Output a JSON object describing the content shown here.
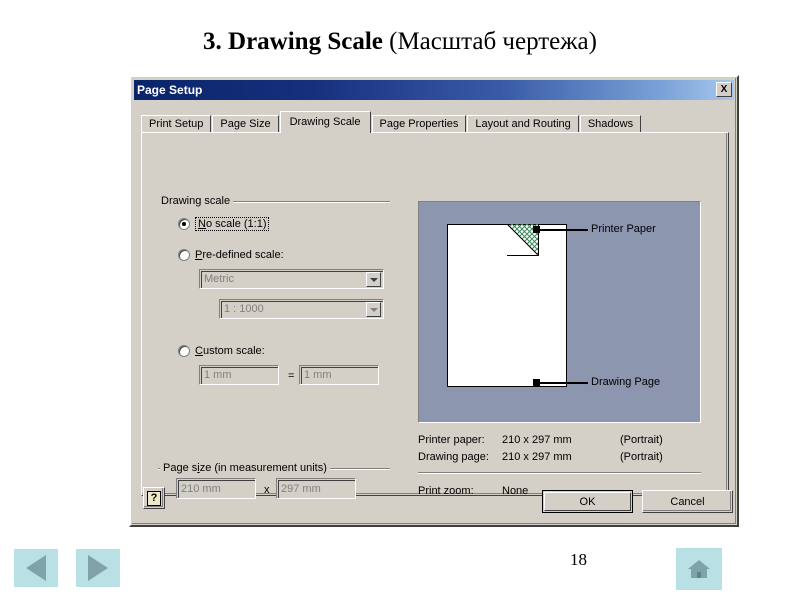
{
  "slide": {
    "title_bold": "3. Drawing Scale",
    "title_regular": "(Масштаб чертежа)",
    "page_number": "18"
  },
  "dialog": {
    "title": "Page Setup",
    "close_label": "X",
    "tabs": [
      {
        "label": "Print Setup",
        "active": false
      },
      {
        "label": "Page Size",
        "active": false
      },
      {
        "label": "Drawing Scale",
        "active": true
      },
      {
        "label": "Page Properties",
        "active": false
      },
      {
        "label": "Layout and Routing",
        "active": false
      },
      {
        "label": "Shadows",
        "active": false
      }
    ],
    "drawing_scale_group": {
      "legend": "Drawing scale",
      "option_no_scale": "No scale (1:1)",
      "option_predefined": "Pre-defined scale:",
      "option_custom": "Custom scale:",
      "predefined_units": "Metric",
      "predefined_ratio": "1 : 1000",
      "custom_from": "1 mm",
      "custom_equals": "=",
      "custom_to": "1 mm"
    },
    "page_size_group": {
      "legend": "Page size (in measurement units)",
      "width": "210 mm",
      "separator": "x",
      "height": "297 mm"
    },
    "preview": {
      "printer_paper_label": "Printer Paper",
      "drawing_page_label": "Drawing Page"
    },
    "info": {
      "printer_paper_label": "Printer paper:",
      "printer_paper_value": "210 x 297 mm",
      "printer_paper_orientation": "(Portrait)",
      "drawing_page_label": "Drawing page:",
      "drawing_page_value": "210 x 297 mm",
      "drawing_page_orientation": "(Portrait)",
      "print_zoom_label": "Print zoom:",
      "print_zoom_value": "None"
    },
    "buttons": {
      "help": "?",
      "ok": "OK",
      "cancel": "Cancel"
    }
  },
  "colors": {
    "titlebar_start": "#0a246a",
    "titlebar_end": "#a6c8ec",
    "dialog_face": "#d4d0c8",
    "preview_bg": "#8d96af",
    "nav_button_bg": "#b9e0e4",
    "nav_glyph": "#7fa3a8"
  }
}
